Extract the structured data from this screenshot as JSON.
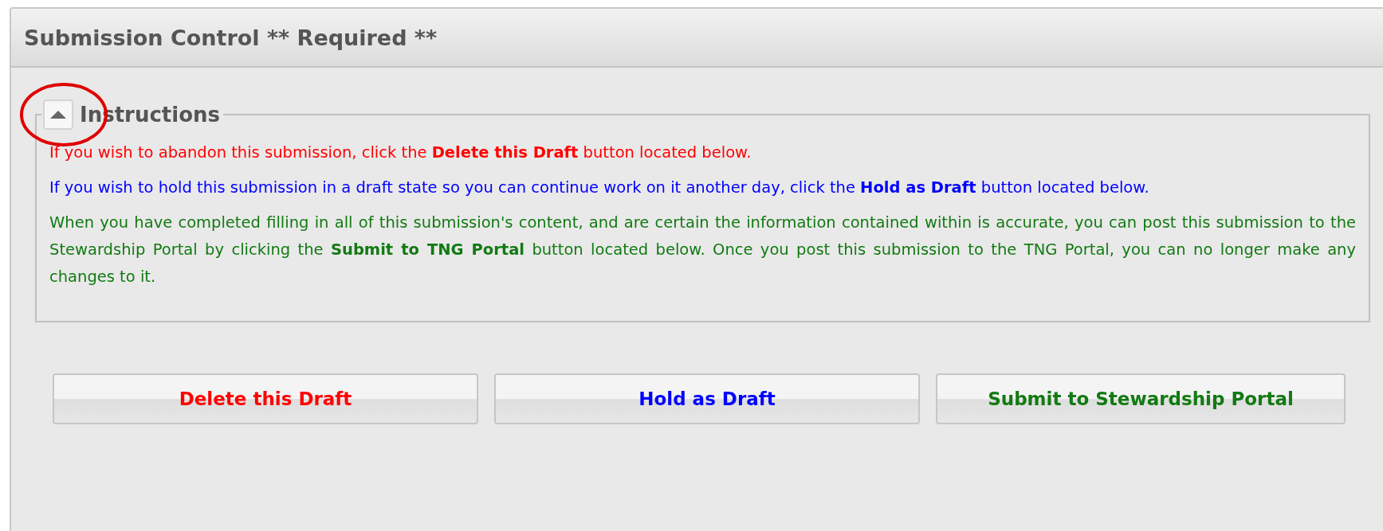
{
  "panel": {
    "title": "Submission Control ** Required **"
  },
  "instructions": {
    "legend": "Instructions",
    "expanded": true,
    "circled": true,
    "paragraphs": [
      {
        "color": "#ff0000",
        "text": "If you wish to abandon this submission, click the **Delete this Draft** button located below."
      },
      {
        "color": "#0000ff",
        "text": "If you wish to hold this submission in a draft state so you can continue work on it another day, click the **Hold as Draft** button located below."
      },
      {
        "color": "#127a12",
        "text": "When you have completed filling in all of this submission's content, and are certain the information contained within is accurate, you can post this submission to the Stewardship Portal by clicking the **Submit to TNG Portal** button located below. Once you post this submission to the TNG Portal, you can no longer make any changes to it."
      }
    ]
  },
  "buttons": [
    {
      "label": "Delete this Draft",
      "color": "#ff0000"
    },
    {
      "label": "Hold as Draft",
      "color": "#0000ff"
    },
    {
      "label": "Submit to Stewardship Portal",
      "color": "#127a12"
    }
  ]
}
